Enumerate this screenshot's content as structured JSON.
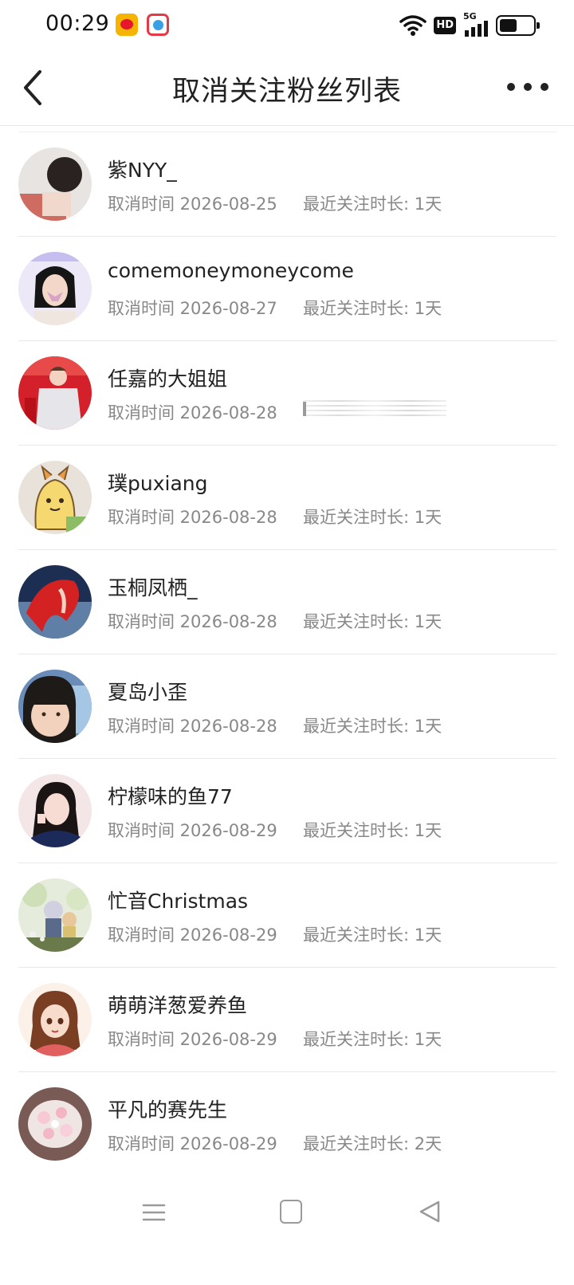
{
  "status_bar": {
    "time": "00:29",
    "hd_label": "HD",
    "network_label": "5G",
    "battery_level": 0.55,
    "icons": [
      "weibo-icon",
      "app-notification-icon",
      "wifi-icon",
      "hd-icon",
      "signal-icon",
      "battery-icon"
    ]
  },
  "header": {
    "title": "取消关注粉丝列表",
    "back_icon": "back-chevron-icon",
    "more_icon": "more-dots-icon"
  },
  "rows": [
    {
      "name": "紫NYY_",
      "cancel_time": "取消时间 2026-08-25",
      "duration": "最近关注时长: 1天"
    },
    {
      "name": "comemoneymoneycome",
      "cancel_time": "取消时间 2026-08-27",
      "duration": "最近关注时长: 1天"
    },
    {
      "name": "任嘉的大姐姐",
      "cancel_time": "取消时间 2026-08-28",
      "duration": ""
    },
    {
      "name": "璞puxiang",
      "cancel_time": "取消时间 2026-08-28",
      "duration": "最近关注时长: 1天"
    },
    {
      "name": "玉桐凤栖_",
      "cancel_time": "取消时间 2026-08-28",
      "duration": "最近关注时长: 1天"
    },
    {
      "name": "夏岛小歪",
      "cancel_time": "取消时间 2026-08-28",
      "duration": "最近关注时长: 1天"
    },
    {
      "name": "柠檬味的鱼77",
      "cancel_time": "取消时间 2026-08-29",
      "duration": "最近关注时长: 1天"
    },
    {
      "name": "忙音Christmas",
      "cancel_time": "取消时间 2026-08-29",
      "duration": "最近关注时长: 1天"
    },
    {
      "name": "萌萌洋葱爱养鱼",
      "cancel_time": "取消时间 2026-08-29",
      "duration": "最近关注时长: 1天"
    },
    {
      "name": "平凡的赛先生",
      "cancel_time": "取消时间 2026-08-29",
      "duration": "最近关注时长: 2天"
    }
  ],
  "nav_bar": {
    "icons": [
      "menu-icon",
      "home-square-icon",
      "back-triangle-icon"
    ]
  },
  "colors": {
    "text_primary": "#222222",
    "text_secondary": "#888888",
    "divider": "#e9e9e9",
    "background": "#ffffff"
  }
}
